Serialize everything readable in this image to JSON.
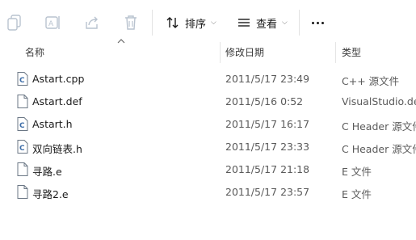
{
  "toolbar": {
    "icons": [
      "copy-icon",
      "rename-icon",
      "share-icon",
      "delete-icon"
    ],
    "sort": {
      "label": "排序",
      "icon": "sort-arrows-icon"
    },
    "view": {
      "label": "查看",
      "icon": "view-lines-icon"
    },
    "more_icon": "more-dots-icon"
  },
  "columns": {
    "name": "名称",
    "modified": "修改日期",
    "type": "类型"
  },
  "files": [
    {
      "name": "Astart.cpp",
      "modified": "2011/5/17 23:49",
      "type": "C++ 源文件",
      "icon": "c-source-file-icon"
    },
    {
      "name": "Astart.def",
      "modified": "2011/5/16 0:52",
      "type": "VisualStudio.def",
      "icon": "blank-file-icon"
    },
    {
      "name": "Astart.h",
      "modified": "2011/5/17 16:17",
      "type": "C Header 源文件",
      "icon": "c-source-file-icon"
    },
    {
      "name": "双向链表.h",
      "modified": "2011/5/17 23:33",
      "type": "C Header 源文件",
      "icon": "c-source-file-icon"
    },
    {
      "name": "寻路.e",
      "modified": "2011/5/17 21:18",
      "type": "E 文件",
      "icon": "blank-file-icon"
    },
    {
      "name": "寻路2.e",
      "modified": "2011/5/17 23:57",
      "type": "E 文件",
      "icon": "blank-file-icon"
    }
  ],
  "colors": {
    "icon_disabled": "#b9c3cf",
    "separator": "#e5e5e5"
  }
}
